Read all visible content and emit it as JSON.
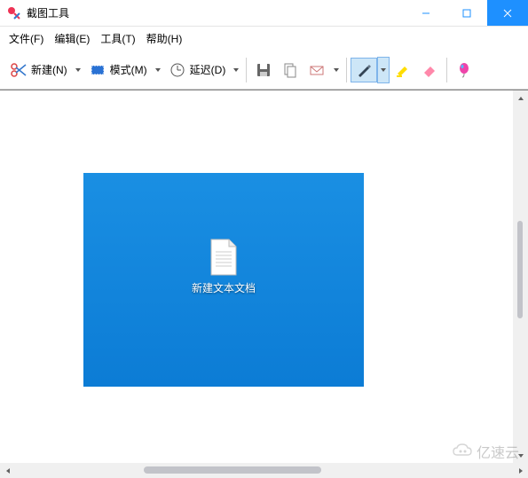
{
  "window": {
    "title": "截图工具"
  },
  "menu": {
    "file": "文件(F)",
    "edit": "编辑(E)",
    "tools": "工具(T)",
    "help": "帮助(H)"
  },
  "toolbar": {
    "new_label": "新建(N)",
    "mode_label": "模式(M)",
    "delay_label": "延迟(D)"
  },
  "snip": {
    "file_label": "新建文本文档"
  },
  "watermark": {
    "text": "亿速云"
  }
}
